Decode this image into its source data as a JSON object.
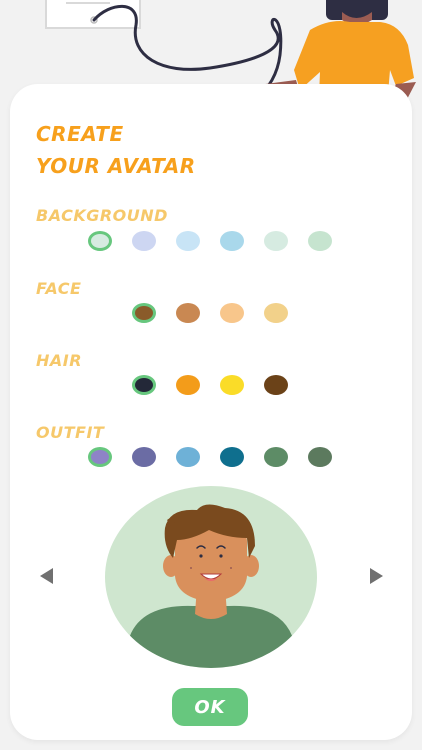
{
  "title": {
    "line1": "CREATE",
    "line2": "YOUR AVATAR"
  },
  "sections": {
    "background": {
      "label": "BACKGROUND",
      "selected_index": 0,
      "swatches": [
        "#d6ebe1",
        "#cdd6f2",
        "#c8e4f6",
        "#a9d8eb",
        "#d6ebe1",
        "#c6e4cf"
      ]
    },
    "face": {
      "label": "FACE",
      "selected_index": 0,
      "swatches": [
        "#8a5b2a",
        "#c98852",
        "#f8c68b",
        "#f2d18a"
      ]
    },
    "hair": {
      "label": "HAIR",
      "selected_index": 0,
      "swatches": [
        "#232838",
        "#f39c1a",
        "#fadc28",
        "#6b4218"
      ]
    },
    "outfit": {
      "label": "OUTFIT",
      "selected_index": 0,
      "swatches": [
        "#8e83c7",
        "#6b6ca4",
        "#6eb1d7",
        "#0f6f8e",
        "#5d8c66",
        "#5c7a5e"
      ]
    }
  },
  "ok_label": "OK",
  "colors": {
    "accent": "#67c77e",
    "title": "#f7a01c",
    "section_label": "#f6c86a",
    "avatar_background": "#cfe6cf",
    "avatar_skin": "#d9905c",
    "avatar_hair": "#7a4a1e",
    "avatar_shirt": "#5d8c66"
  }
}
